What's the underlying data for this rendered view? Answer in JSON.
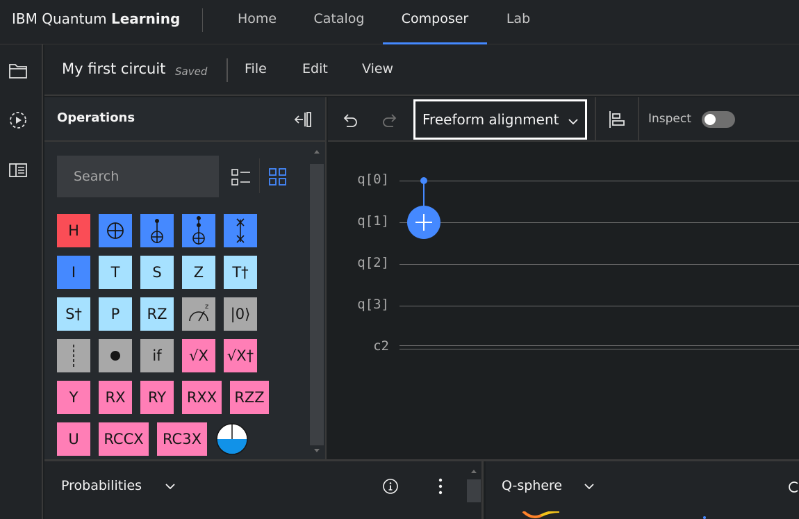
{
  "app": {
    "brand_regular": "IBM Quantum ",
    "brand_bold": "Learning"
  },
  "nav": {
    "tabs": [
      {
        "label": "Home"
      },
      {
        "label": "Catalog"
      },
      {
        "label": "Composer",
        "active": true
      },
      {
        "label": "Lab"
      }
    ]
  },
  "rail": {
    "icons": [
      "folder-icon",
      "history-play-icon",
      "side-panel-icon"
    ]
  },
  "titlebar": {
    "circuit_name": "My first circuit",
    "status": "Saved",
    "menu": [
      "File",
      "Edit",
      "View"
    ]
  },
  "operations": {
    "title": "Operations",
    "search_placeholder": "Search",
    "gates": {
      "h": "H",
      "i": "I",
      "t": "T",
      "s": "S",
      "z": "Z",
      "tdg": "T†",
      "sdg": "S†",
      "p": "P",
      "rz": "RZ",
      "reset": "|0⟩",
      "if": "if",
      "sx": "√X",
      "sxdg": "√X†",
      "y": "Y",
      "rx": "RX",
      "ry": "RY",
      "rxx": "RXX",
      "rzz": "RZZ",
      "u": "U",
      "rccx": "RCCX",
      "rc3x": "RC3X"
    },
    "colors": {
      "red": "#fa4d56",
      "blue": "#4589ff",
      "light_blue": "#a6e1ff",
      "gray": "#a8a8a8",
      "pink": "#ff7eb6"
    }
  },
  "toolbar": {
    "alignment": "Freeform alignment",
    "inspect_label": "Inspect",
    "inspect_on": false
  },
  "circuit": {
    "wires": [
      "q[0]",
      "q[1]",
      "q[2]",
      "q[3]"
    ],
    "classical": "c2",
    "gates": [
      {
        "type": "cnot",
        "control": "q[0]",
        "target": "q[1]"
      }
    ],
    "accent": "#4589ff"
  },
  "panels": {
    "probabilities": "Probabilities",
    "qsphere": "Q-sphere"
  }
}
